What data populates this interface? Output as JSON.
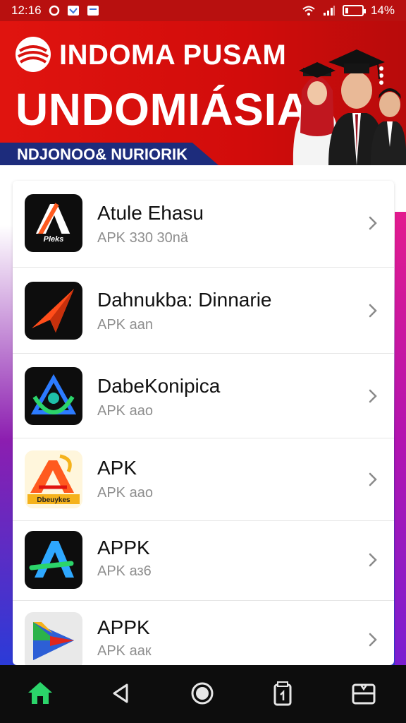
{
  "status_bar": {
    "time": "12:16",
    "battery": "14%",
    "icons": [
      "notification-circle-icon",
      "photo-icon",
      "message-icon",
      "wifi-icon",
      "signal-icon",
      "battery-icon"
    ]
  },
  "banner": {
    "title_line1": "INDOMA PUSAM",
    "title_line2": "UNDOMIÁSIA",
    "subtitle": "NDJONOO& NURIORIK",
    "colors": {
      "red": "#d9120e",
      "navy": "#1d2c7c"
    }
  },
  "apps": [
    {
      "name": "Atule Ehasu",
      "sub": "APK 330 30nä",
      "icon": "atule-app-icon",
      "icon_text": "Pleks"
    },
    {
      "name": "Dahnukba: Dinnarie",
      "sub": "APK ааn",
      "icon": "arrow-app-icon"
    },
    {
      "name": "DabeKonipica",
      "sub": "APK ааo",
      "icon": "triangle-app-icon"
    },
    {
      "name": "APK",
      "sub": "APK ааo",
      "icon": "apk-letter-app-icon",
      "icon_text": "Dbeuykes"
    },
    {
      "name": "APPK",
      "sub": "APK аз6",
      "icon": "a-letter-app-icon"
    },
    {
      "name": "APPK",
      "sub": "APK аак",
      "icon": "play-app-icon"
    }
  ],
  "nav": [
    "home-icon",
    "back-icon",
    "home-circle-icon",
    "recents-icon",
    "menu-icon"
  ]
}
